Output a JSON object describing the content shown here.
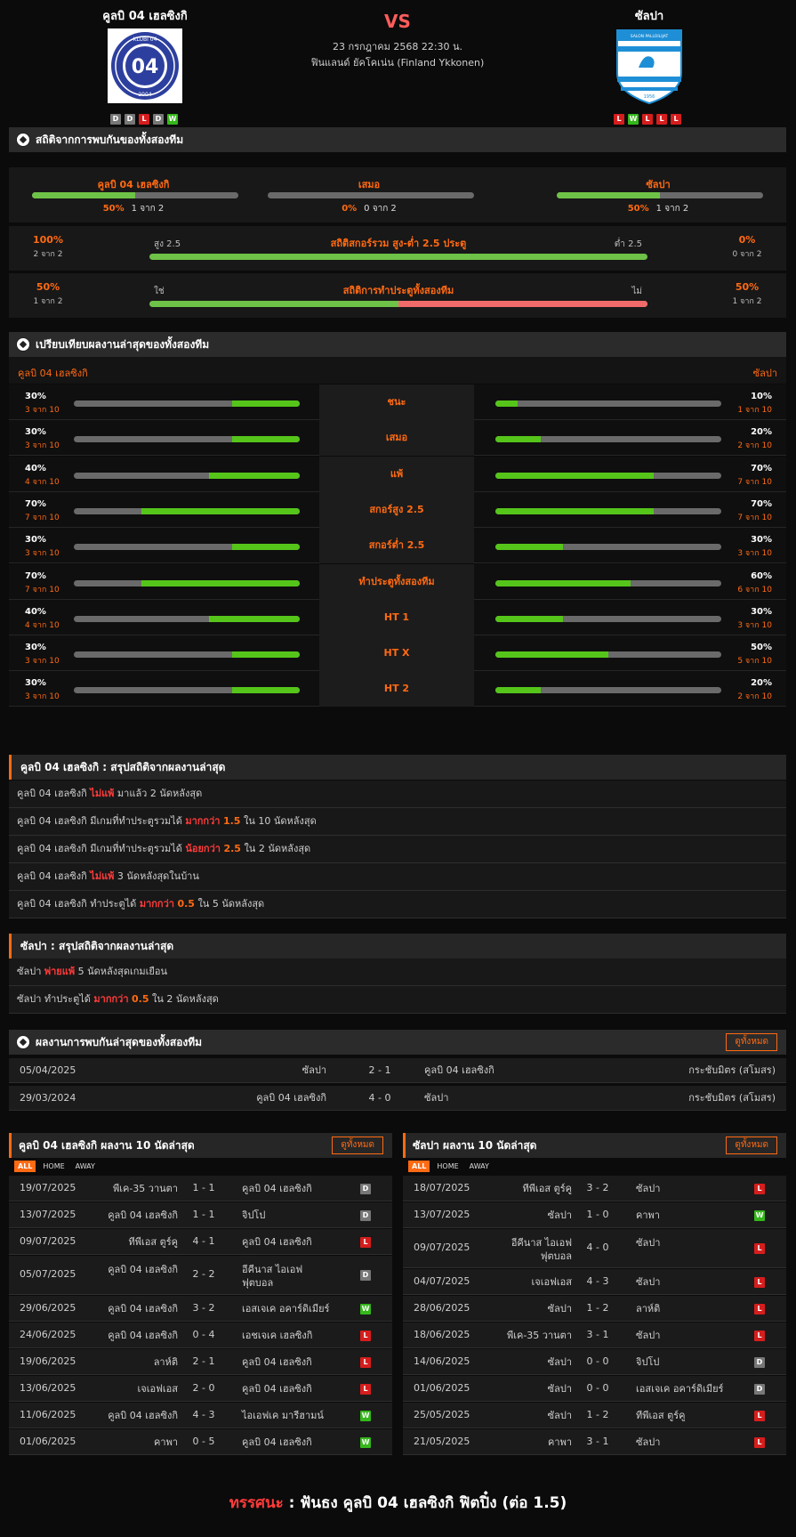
{
  "header": {
    "home": "คูลบิ 04 เฮลซิงกิ",
    "away": "ซัลปา",
    "vs": "VS",
    "date": "23 กรกฎาคม 2568 22:30 น.",
    "league": "ฟินแลนด์ ยัคโคเน่น (Finland Ykkonen)",
    "home_logo_text": "KLUBI 04",
    "home_logo_year": "2004",
    "away_logo_text": "SALON PALLOILIJAT",
    "away_logo_year": "1956",
    "home_form": [
      "D",
      "D",
      "L",
      "D",
      "W"
    ],
    "away_form": [
      "L",
      "W",
      "L",
      "L",
      "L"
    ]
  },
  "colors": {
    "accent": "#ff6a13",
    "win": "#35b71b",
    "loss": "#d61d1d",
    "draw": "#777777",
    "bar_green": "#6ec247",
    "bar_red": "#f06a6a"
  },
  "h2h_stats": {
    "title": "สถิติจากการพบกันของทั้งสองทีม",
    "cols": [
      {
        "label": "คูลบิ 04 เฮลซิงกิ",
        "pct": "50%",
        "count": "1 จาก 2",
        "value": 0.5
      },
      {
        "label": "เสมอ",
        "pct": "0%",
        "count": "0 จาก 2",
        "value": 0
      },
      {
        "label": "ซัลปา",
        "pct": "50%",
        "count": "1 จาก 2",
        "value": 0.5
      }
    ],
    "ou": {
      "title": "สถิติสกอร์รวม สูง-ต่ำ 2.5 ประตู",
      "left_label": "สูง 2.5",
      "right_label": "ต่ำ 2.5",
      "left_pct": "100%",
      "left_count": "2 จาก 2",
      "right_pct": "0%",
      "right_count": "0 จาก 2",
      "left_value": 1.0
    },
    "btts": {
      "title": "สถิติการทำประตูทั้งสองทีม",
      "left_label": "ใช่",
      "right_label": "ไม่",
      "left_pct": "50%",
      "left_count": "1 จาก 2",
      "right_pct": "50%",
      "right_count": "1 จาก 2",
      "left_value": 0.5
    }
  },
  "compare": {
    "title": "เปรียบเทียบผลงานล่าสุดของทั้งสองทีม",
    "home": "คูลบิ 04 เฮลซิงกิ",
    "away": "ซัลปา",
    "rows": [
      {
        "label": "ชนะ",
        "hp": "30%",
        "hc": "3 จาก 10",
        "hv": 0.3,
        "ap": "10%",
        "ac": "1 จาก 10",
        "av": 0.1
      },
      {
        "label": "เสมอ",
        "hp": "30%",
        "hc": "3 จาก 10",
        "hv": 0.3,
        "ap": "20%",
        "ac": "2 จาก 10",
        "av": 0.2
      },
      {
        "label": "แพ้",
        "hp": "40%",
        "hc": "4 จาก 10",
        "hv": 0.4,
        "ap": "70%",
        "ac": "7 จาก 10",
        "av": 0.7
      },
      {
        "label": "สกอร์สูง 2.5",
        "hp": "70%",
        "hc": "7 จาก 10",
        "hv": 0.7,
        "ap": "70%",
        "ac": "7 จาก 10",
        "av": 0.7
      },
      {
        "label": "สกอร์ต่ำ 2.5",
        "hp": "30%",
        "hc": "3 จาก 10",
        "hv": 0.3,
        "ap": "30%",
        "ac": "3 จาก 10",
        "av": 0.3
      },
      {
        "label": "ทำประตูทั้งสองทีม",
        "hp": "70%",
        "hc": "7 จาก 10",
        "hv": 0.7,
        "ap": "60%",
        "ac": "6 จาก 10",
        "av": 0.6
      },
      {
        "label": "HT 1",
        "hp": "40%",
        "hc": "4 จาก 10",
        "hv": 0.4,
        "ap": "30%",
        "ac": "3 จาก 10",
        "av": 0.3
      },
      {
        "label": "HT X",
        "hp": "30%",
        "hc": "3 จาก 10",
        "hv": 0.3,
        "ap": "50%",
        "ac": "5 จาก 10",
        "av": 0.5
      },
      {
        "label": "HT 2",
        "hp": "30%",
        "hc": "3 จาก 10",
        "hv": 0.3,
        "ap": "20%",
        "ac": "2 จาก 10",
        "av": 0.2
      }
    ]
  },
  "home_summary": {
    "title": "คูลบิ 04 เฮลซิงกิ : สรุปสถิติจากผลงานล่าสุด",
    "rows": [
      {
        "pre": "คูลบิ 04 เฮลซิงกิ",
        "hl": "ไม่แพ้",
        "hl_style": "red",
        "mid": "",
        "post": "มาแล้ว 2 นัดหลังสุด"
      },
      {
        "pre": "คูลบิ 04 เฮลซิงกิ มีเกมที่ทำประตูรวมได้",
        "hl": "มากกว่า",
        "hl_style": "red",
        "mid": "1.5",
        "post": "ใน 10 นัดหลังสุด"
      },
      {
        "pre": "คูลบิ 04 เฮลซิงกิ มีเกมที่ทำประตูรวมได้",
        "hl": "น้อยกว่า",
        "hl_style": "red",
        "mid": "2.5",
        "post": "ใน 2 นัดหลังสุด"
      },
      {
        "pre": "คูลบิ 04 เฮลซิงกิ",
        "hl": "ไม่แพ้",
        "hl_style": "red",
        "mid": "",
        "post": "3 นัดหลังสุดในบ้าน"
      },
      {
        "pre": "คูลบิ 04 เฮลซิงกิ ทำประตูได้",
        "hl": "มากกว่า",
        "hl_style": "red",
        "mid": "0.5",
        "post": "ใน 5 นัดหลังสุด"
      }
    ]
  },
  "away_summary": {
    "title": "ซัลปา : สรุปสถิติจากผลงานล่าสุด",
    "rows": [
      {
        "pre": "ซัลปา",
        "hl": "พ่ายแพ้",
        "hl_style": "red",
        "mid": "",
        "post": "5 นัดหลังสุดเกมเยือน"
      },
      {
        "pre": "ซัลปา ทำประตูได้",
        "hl": "มากกว่า",
        "hl_style": "red",
        "mid": "0.5",
        "post": "ใน 2 นัดหลังสุด"
      }
    ]
  },
  "h2h_results": {
    "title": "ผลงานการพบกันล่าสุดของทั้งสองทีม",
    "view_all": "ดูทั้งหมด",
    "rows": [
      {
        "date": "05/04/2025",
        "home": "ซัลปา",
        "score": "2 - 1",
        "away": "คูลบิ 04 เฮลซิงกิ",
        "comp": "กระชับมิตร (สโมสร)"
      },
      {
        "date": "29/03/2024",
        "home": "คูลบิ 04 เฮลซิงกิ",
        "score": "4 - 0",
        "away": "ซัลปา",
        "comp": "กระชับมิตร (สโมสร)"
      }
    ]
  },
  "home_last10": {
    "title": "คูลบิ 04 เฮลซิงกิ ผลงาน 10 นัดล่าสุด",
    "view_all": "ดูทั้งหมด",
    "filters": [
      "ALL",
      "HOME",
      "AWAY"
    ],
    "rows": [
      {
        "date": "19/07/2025",
        "home": "พีเค-35 วานตา",
        "score": "1 - 1",
        "away": "คูลบิ 04 เฮลซิงกิ",
        "res": "D"
      },
      {
        "date": "13/07/2025",
        "home": "คูลบิ 04 เฮลซิงกิ",
        "score": "1 - 1",
        "away": "จิปโป",
        "res": "D"
      },
      {
        "date": "09/07/2025",
        "home": "ทีพีเอส ตูร์คู",
        "score": "4 - 1",
        "away": "คูลบิ 04 เฮลซิงกิ",
        "res": "L"
      },
      {
        "date": "05/07/2025",
        "home": "คูลบิ 04 เฮลซิงกิ",
        "score": "2 - 2",
        "away": "อีคีนาส ไอเอฟ ฟุตบอล",
        "res": "D"
      },
      {
        "date": "29/06/2025",
        "home": "คูลบิ 04 เฮลซิงกิ",
        "score": "3 - 2",
        "away": "เอสเจเค อคาร์ดิเมียร์",
        "res": "W"
      },
      {
        "date": "24/06/2025",
        "home": "คูลบิ 04 เฮลซิงกิ",
        "score": "0 - 4",
        "away": "เอชเจเค เฮลซิงกิ",
        "res": "L"
      },
      {
        "date": "19/06/2025",
        "home": "ลาห์ติ",
        "score": "2 - 1",
        "away": "คูลบิ 04 เฮลซิงกิ",
        "res": "L"
      },
      {
        "date": "13/06/2025",
        "home": "เจเอฟเอส",
        "score": "2 - 0",
        "away": "คูลบิ 04 เฮลซิงกิ",
        "res": "L"
      },
      {
        "date": "11/06/2025",
        "home": "คูลบิ 04 เฮลซิงกิ",
        "score": "4 - 3",
        "away": "ไอเอฟเค มารีฮามน์",
        "res": "W"
      },
      {
        "date": "01/06/2025",
        "home": "คาพา",
        "score": "0 - 5",
        "away": "คูลบิ 04 เฮลซิงกิ",
        "res": "W"
      }
    ]
  },
  "away_last10": {
    "title": "ซัลปา ผลงาน 10 นัดล่าสุด",
    "view_all": "ดูทั้งหมด",
    "filters": [
      "ALL",
      "HOME",
      "AWAY"
    ],
    "rows": [
      {
        "date": "18/07/2025",
        "home": "ทีพีเอส ตูร์คู",
        "score": "3 - 2",
        "away": "ซัลปา",
        "res": "L"
      },
      {
        "date": "13/07/2025",
        "home": "ซัลปา",
        "score": "1 - 0",
        "away": "คาพา",
        "res": "W"
      },
      {
        "date": "09/07/2025",
        "home": "อีคีนาส ไอเอฟ ฟุตบอล",
        "score": "4 - 0",
        "away": "ซัลปา",
        "res": "L"
      },
      {
        "date": "04/07/2025",
        "home": "เจเอฟเอส",
        "score": "4 - 3",
        "away": "ซัลปา",
        "res": "L"
      },
      {
        "date": "28/06/2025",
        "home": "ซัลปา",
        "score": "1 - 2",
        "away": "ลาห์ติ",
        "res": "L"
      },
      {
        "date": "18/06/2025",
        "home": "พีเค-35 วานตา",
        "score": "3 - 1",
        "away": "ซัลปา",
        "res": "L"
      },
      {
        "date": "14/06/2025",
        "home": "ซัลปา",
        "score": "0 - 0",
        "away": "จิปโป",
        "res": "D"
      },
      {
        "date": "01/06/2025",
        "home": "ซัลปา",
        "score": "0 - 0",
        "away": "เอสเจเค อคาร์ดิเมียร์",
        "res": "D"
      },
      {
        "date": "25/05/2025",
        "home": "ซัลปา",
        "score": "1 - 2",
        "away": "ทีพีเอส ตูร์คู",
        "res": "L"
      },
      {
        "date": "21/05/2025",
        "home": "คาพา",
        "score": "3 - 1",
        "away": "ซัลปา",
        "res": "L"
      }
    ]
  },
  "verdict": {
    "label": "ทรรศนะ",
    "sep": " : ",
    "text": "ฟันธง คูลบิ 04 เฮลซิงกิ ฟิตปิ๋ง (ต่อ 1.5)"
  }
}
